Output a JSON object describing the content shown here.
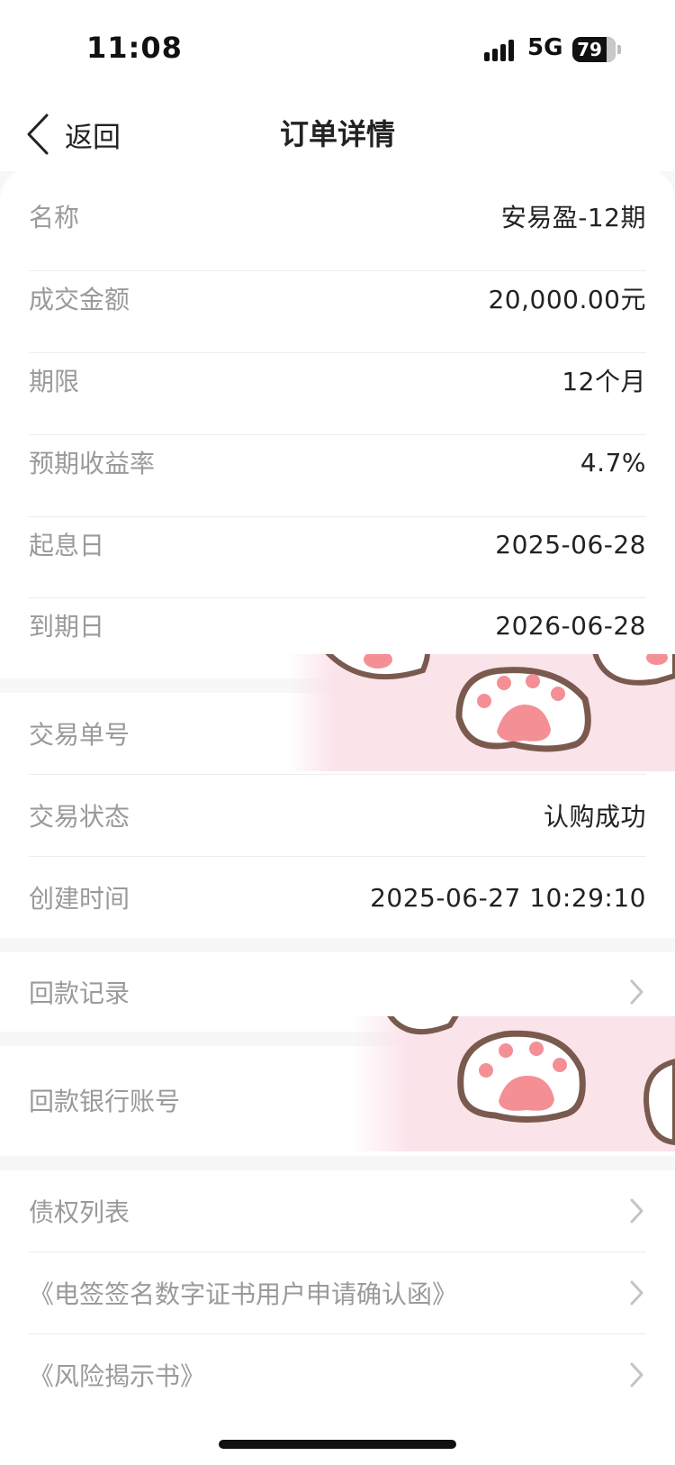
{
  "status_bar": {
    "time": "11:08",
    "network": "5G",
    "battery": "79"
  },
  "nav": {
    "back_label": "返回",
    "title": "订单详情"
  },
  "order": {
    "name": {
      "label": "名称",
      "value": "安易盈-12期"
    },
    "amount": {
      "label": "成交金额",
      "value": "20,000.00元"
    },
    "term": {
      "label": "期限",
      "value": "12个月"
    },
    "expected_yield": {
      "label": "预期收益率",
      "value": "4.7%"
    },
    "value_date": {
      "label": "起息日",
      "value": "2025-06-28"
    },
    "maturity_date": {
      "label": "到期日",
      "value": "2026-06-28"
    }
  },
  "transaction": {
    "number": {
      "label": "交易单号",
      "value": ""
    },
    "status": {
      "label": "交易状态",
      "value": "认购成功"
    },
    "created": {
      "label": "创建时间",
      "value": "2025-06-27 10:29:10"
    }
  },
  "repayment": {
    "records": {
      "label": "回款记录"
    },
    "bank_account": {
      "label": "回款银行账号",
      "value": ""
    }
  },
  "documents": [
    {
      "label": "债权列表"
    },
    {
      "label": "《电签签名数字证书用户申请确认函》"
    },
    {
      "label": "《风险揭示书》"
    }
  ],
  "colors": {
    "label_gray": "#9a9a9a",
    "value_dark": "#222222",
    "sticker_pink": "#fbe3ea",
    "sticker_brown": "#7a5a4e",
    "paw_pink": "#f48f96"
  },
  "icons": {
    "back": "chevron-left-icon",
    "row_arrow": "chevron-right-icon",
    "sticker": "cat-paw-sticker"
  }
}
